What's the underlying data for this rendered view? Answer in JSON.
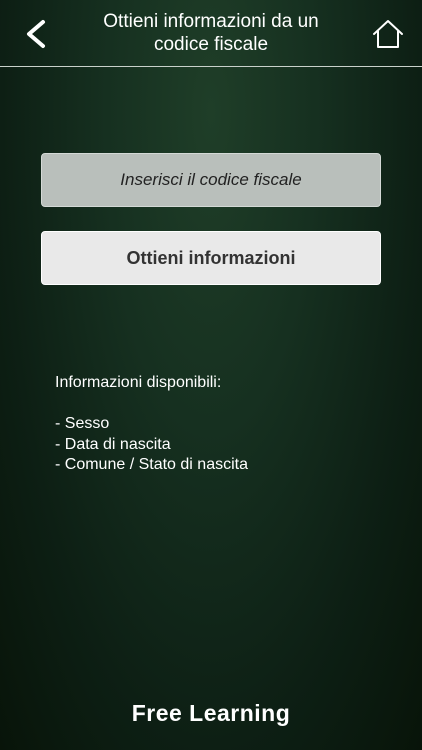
{
  "header": {
    "title_line1": "Ottieni informazioni da un",
    "title_line2": "codice fiscale",
    "back_icon": "chevron-left-icon",
    "home_icon": "home-icon"
  },
  "form": {
    "input_placeholder": "Inserisci il codice fiscale",
    "input_value": "",
    "submit_label": "Ottieni informazioni"
  },
  "info": {
    "heading": "Informazioni disponibili:",
    "items": [
      "- Sesso",
      "- Data di nascita",
      "- Comune / Stato di nascita"
    ]
  },
  "footer": {
    "brand": "Free Learning"
  },
  "colors": {
    "background": "#163020",
    "input_background": "#b9bfbb",
    "button_background": "#e9e9e9",
    "text": "#ffffff"
  }
}
